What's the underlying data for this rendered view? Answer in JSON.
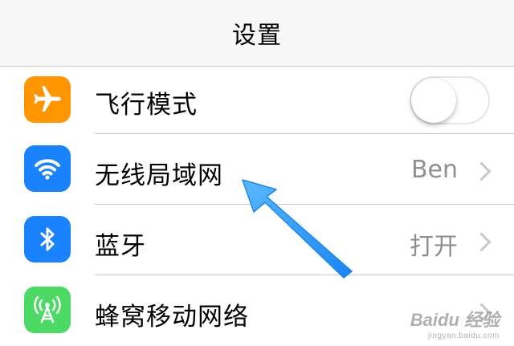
{
  "navbar": {
    "title": "设置"
  },
  "rows": [
    {
      "label": "飞行模式",
      "icon": "airplane-icon",
      "icon_color": "#ff9500",
      "toggle_on": false
    },
    {
      "label": "无线局域网",
      "value": "Ben",
      "icon": "wifi-icon",
      "icon_color": "#1a82fb"
    },
    {
      "label": "蓝牙",
      "value": "打开",
      "icon": "bluetooth-icon",
      "icon_color": "#1a82fb"
    },
    {
      "label": "蜂窝移动网络",
      "icon": "cellular-icon",
      "icon_color": "#4cd964"
    }
  ],
  "annotation": {
    "arrow_color": "#2f9bff"
  },
  "watermark": {
    "main": "Baidu 经验",
    "sub": "jingyan.baidu.com"
  }
}
